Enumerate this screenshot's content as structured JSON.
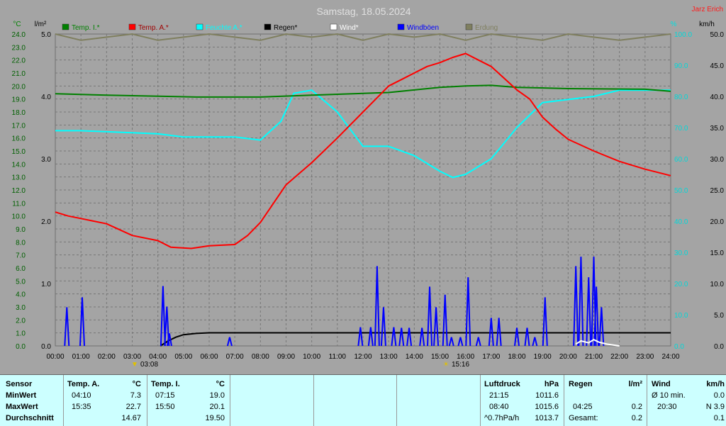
{
  "title": "Samstag, 18.05.2024",
  "author": "Jarz Erich",
  "units": {
    "left1": "°C",
    "left2": "l/m²",
    "right1": "%",
    "right2": "km/h"
  },
  "legend": [
    {
      "label": "Temp. I.*",
      "color": "#008000"
    },
    {
      "label": "Temp. A.*",
      "color": "#ff0000"
    },
    {
      "label": "Feuchte A.*",
      "color": "#00ffff"
    },
    {
      "label": "Regen*",
      "color": "#000000"
    },
    {
      "label": "Wind*",
      "color": "#ffffff"
    },
    {
      "label": "Windböen",
      "color": "#0000ff"
    },
    {
      "label": "Erdung",
      "color": "#7f7f5f"
    }
  ],
  "markers": {
    "min": "03:08",
    "max": "15:16"
  },
  "chart_data": {
    "type": "line",
    "x_unit": "hours",
    "xlim": [
      0,
      24
    ],
    "x_ticks": [
      "00:00",
      "01:00",
      "02:00",
      "03:00",
      "04:00",
      "05:00",
      "06:00",
      "07:00",
      "08:00",
      "09:00",
      "10:00",
      "11:00",
      "12:00",
      "13:00",
      "14:00",
      "15:00",
      "16:00",
      "17:00",
      "18:00",
      "19:00",
      "20:00",
      "21:00",
      "22:00",
      "23:00",
      "24:00"
    ],
    "axes": {
      "temp": {
        "unit": "°C",
        "range": [
          0,
          24
        ],
        "ticks": [
          "0.0",
          "1.0",
          "2.0",
          "3.0",
          "4.0",
          "5.0",
          "6.0",
          "7.0",
          "8.0",
          "9.0",
          "10.0",
          "11.0",
          "12.0",
          "13.0",
          "14.0",
          "15.0",
          "16.0",
          "17.0",
          "18.0",
          "19.0",
          "20.0",
          "21.0",
          "22.0",
          "23.0",
          "24.0"
        ]
      },
      "rain": {
        "unit": "l/m²",
        "range": [
          0,
          5
        ],
        "ticks": [
          "0.0",
          "1.0",
          "2.0",
          "3.0",
          "4.0",
          "5.0"
        ]
      },
      "humidity": {
        "unit": "%",
        "range": [
          0,
          100
        ],
        "ticks": [
          "0.0",
          "10.0",
          "20.0",
          "30.0",
          "40.0",
          "50.0",
          "60.0",
          "70.0",
          "80.0",
          "90.0",
          "100.0"
        ]
      },
      "wind": {
        "unit": "km/h",
        "range": [
          0,
          50
        ],
        "ticks": [
          "0.0",
          "5.0",
          "10.0",
          "15.0",
          "20.0",
          "25.0",
          "30.0",
          "35.0",
          "40.0",
          "45.0",
          "50.0"
        ]
      }
    },
    "series": [
      {
        "name": "Temp. I.*",
        "axis": "temp",
        "color": "#008000",
        "x": [
          0,
          2,
          5.5,
          8,
          10,
          13,
          15,
          16,
          17,
          18,
          20,
          23,
          24
        ],
        "y": [
          19.4,
          19.3,
          19.15,
          19.15,
          19.3,
          19.5,
          19.9,
          20.0,
          20.05,
          19.9,
          19.8,
          19.75,
          19.6
        ]
      },
      {
        "name": "Temp. A.*",
        "axis": "temp",
        "color": "#ff0000",
        "x": [
          0,
          0.5,
          1,
          2,
          3,
          4,
          4.5,
          5.3,
          6,
          7,
          7.5,
          8,
          9,
          10,
          11,
          12,
          12.5,
          13,
          13.5,
          14,
          14.5,
          15,
          15.5,
          16,
          16.5,
          17,
          17.5,
          18,
          18.5,
          19,
          19.5,
          20,
          21,
          22,
          23,
          24
        ],
        "y": [
          10.3,
          10.0,
          9.8,
          9.4,
          8.5,
          8.1,
          7.6,
          7.5,
          7.7,
          7.8,
          8.5,
          9.5,
          12.4,
          14.1,
          16.0,
          18.0,
          19.0,
          20.0,
          20.5,
          21.0,
          21.5,
          21.8,
          22.2,
          22.5,
          22.0,
          21.5,
          20.6,
          19.7,
          19.0,
          17.6,
          16.7,
          15.9,
          15.0,
          14.2,
          13.6,
          13.1
        ]
      },
      {
        "name": "Feuchte A.*",
        "axis": "humidity",
        "color": "#00ffff",
        "x": [
          0,
          1,
          4,
          5,
          7,
          8,
          8.8,
          9.3,
          10,
          11,
          12,
          13,
          14,
          15,
          15.5,
          16,
          17,
          18,
          19,
          20,
          21,
          22,
          23,
          24
        ],
        "y": [
          69,
          69,
          68,
          67,
          67,
          66,
          72,
          81,
          82,
          75,
          64,
          64,
          61,
          56,
          54,
          55,
          60,
          70,
          78,
          79,
          80,
          82,
          82,
          82
        ]
      },
      {
        "name": "Regen*",
        "axis": "rain",
        "color": "#000000",
        "x": [
          4.1,
          4.4,
          4.7,
          5.0,
          5.5,
          6.0,
          24
        ],
        "y": [
          0,
          0.08,
          0.14,
          0.18,
          0.2,
          0.21,
          0.21
        ]
      },
      {
        "name": "Erdung",
        "axis": "humidity",
        "color": "#7f7f5f",
        "x": [
          0,
          1,
          2,
          3,
          4,
          5,
          6,
          7,
          8,
          9,
          10,
          11,
          12,
          13,
          14,
          15,
          16,
          17,
          18,
          19,
          20,
          21,
          22,
          23,
          24
        ],
        "y": [
          100,
          98,
          99,
          100,
          98,
          99,
          100,
          99,
          98,
          100,
          99,
          100,
          98,
          100,
          99,
          100,
          98,
          100,
          99,
          98,
          100,
          99,
          98,
          99,
          100
        ]
      }
    ],
    "gusts": {
      "name": "Windböen",
      "axis": "wind",
      "color": "#0000ff",
      "points": [
        [
          0.45,
          6.2
        ],
        [
          1.05,
          7.8
        ],
        [
          4.2,
          9.6
        ],
        [
          4.35,
          6.3
        ],
        [
          4.45,
          2.0
        ],
        [
          6.8,
          1.4
        ],
        [
          11.9,
          3.0
        ],
        [
          12.3,
          3.0
        ],
        [
          12.55,
          12.8
        ],
        [
          12.8,
          6.2
        ],
        [
          13.2,
          3.0
        ],
        [
          13.5,
          2.9
        ],
        [
          13.8,
          2.9
        ],
        [
          14.3,
          2.9
        ],
        [
          14.6,
          9.5
        ],
        [
          14.85,
          6.2
        ],
        [
          15.2,
          8.2
        ],
        [
          15.45,
          1.4
        ],
        [
          15.8,
          1.4
        ],
        [
          16.1,
          11.0
        ],
        [
          16.5,
          1.4
        ],
        [
          17.0,
          4.5
        ],
        [
          17.3,
          4.5
        ],
        [
          18.0,
          2.9
        ],
        [
          18.4,
          2.9
        ],
        [
          18.7,
          1.4
        ],
        [
          19.1,
          7.8
        ],
        [
          20.3,
          12.8
        ],
        [
          20.5,
          14.3
        ],
        [
          20.8,
          11.0
        ],
        [
          21.0,
          14.3
        ],
        [
          21.1,
          9.5
        ],
        [
          21.3,
          6.2
        ]
      ]
    },
    "wind": {
      "name": "Wind*",
      "axis": "wind",
      "color": "#ffffff",
      "x": [
        20.3,
        20.5,
        20.8,
        21.0,
        21.2,
        21.5,
        22.0
      ],
      "y": [
        0.3,
        0.8,
        0.5,
        1.0,
        0.6,
        0.3,
        0
      ]
    }
  },
  "table": {
    "row_labels": [
      "Sensor",
      "MinWert",
      "MaxWert",
      "Durchschnitt"
    ],
    "temp_a": {
      "header": "Temp. A.",
      "unit": "°C",
      "min_time": "04:10",
      "min": "7.3",
      "max_time": "15:35",
      "max": "22.7",
      "avg": "14.67"
    },
    "temp_i": {
      "header": "Temp. I.",
      "unit": "°C",
      "min_time": "07:15",
      "min": "19.0",
      "max_time": "15:50",
      "max": "20.1",
      "avg": "19.50"
    },
    "pressure": {
      "header": "Luftdruck",
      "unit": "hPa",
      "min_time": "21:15",
      "min": "1011.6",
      "max_time": "08:40",
      "max": "1015.6",
      "trend": "^0.7hPa/h",
      "avg": "1013.7"
    },
    "rain": {
      "header": "Regen",
      "unit": "l/m²",
      "max_time": "04:25",
      "max": "0.2",
      "total_label": "Gesamt:",
      "total": "0.2"
    },
    "wind": {
      "header": "Wind",
      "unit": "km/h",
      "avg_label": "Ø 10 min.",
      "avg": "0.0",
      "max_time": "20:30",
      "max": "N 3.9",
      "last": "0.1"
    }
  }
}
